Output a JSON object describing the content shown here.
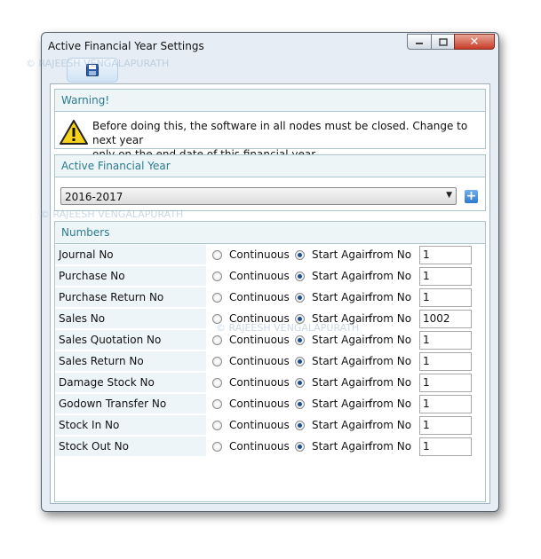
{
  "window": {
    "title": "Active Financial Year Settings",
    "controls": {
      "minimize_icon": "minimize-icon",
      "maximize_icon": "maximize-icon",
      "close_label": "✕"
    }
  },
  "toolbar": {
    "save_icon": "save-icon"
  },
  "warning": {
    "heading": "Warning!",
    "icon": "warning-icon",
    "line1": "Before doing this, the software in all nodes must be closed. Change to next year",
    "line2": "only on the end date of this financial year"
  },
  "active_financial_year": {
    "heading": "Active Financial Year",
    "selected": "2016-2017",
    "add_label": "+"
  },
  "numbers": {
    "heading": "Numbers",
    "continuous_label": "Continuous",
    "start_again_label": "Start Again",
    "from_no_label": "from No",
    "rows": [
      {
        "label": "Journal No",
        "value": "1"
      },
      {
        "label": "Purchase No",
        "value": "1"
      },
      {
        "label": "Purchase Return No",
        "value": "1"
      },
      {
        "label": "Sales No",
        "value": "1002"
      },
      {
        "label": "Sales Quotation No",
        "value": "1"
      },
      {
        "label": "Sales Return No",
        "value": "1"
      },
      {
        "label": "Damage Stock No",
        "value": "1"
      },
      {
        "label": "Godown Transfer No",
        "value": "1"
      },
      {
        "label": "Stock In No",
        "value": "1"
      },
      {
        "label": "Stock Out No",
        "value": "1"
      }
    ]
  },
  "watermark": "© RAJEESH VENGALAPURATH"
}
